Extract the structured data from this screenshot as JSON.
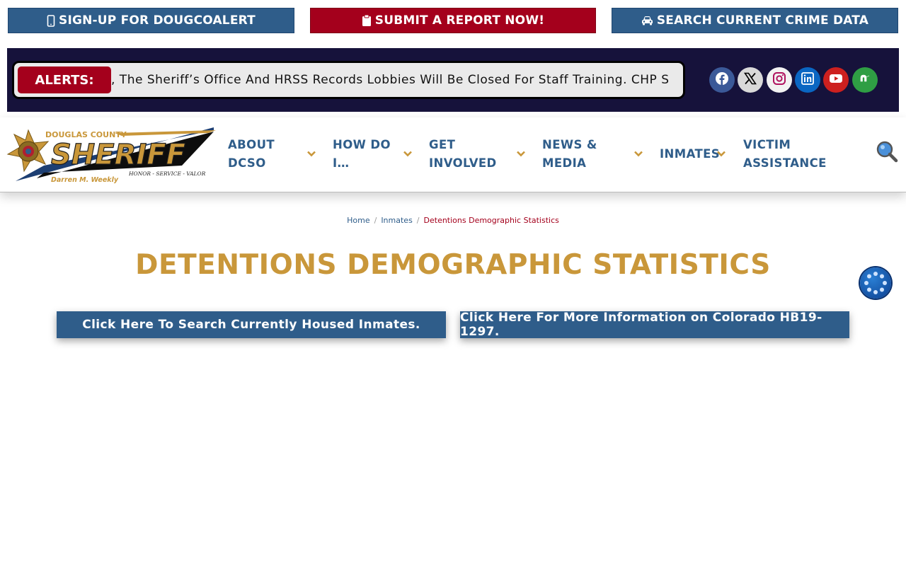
{
  "topbar": {
    "signup_label": "SIGN-UP FOR DOUGCOALERT",
    "report_label": "SUBMIT A REPORT NOW!",
    "crime_label": "SEARCH CURRENT CRIME DATA",
    "blue_color": "#2f5d8a",
    "red_color": "#a4001c"
  },
  "alerts": {
    "label": "ALERTS:",
    "text": ", The Sheriff’s Office And HRSS Records Lobbies Will Be Closed For Staff Training. CHP S",
    "bar_color": "#16123b"
  },
  "social": [
    {
      "icon": "facebook-icon",
      "color": "#3b5998"
    },
    {
      "icon": "x-twitter-icon",
      "color": "#d9d9d9"
    },
    {
      "icon": "instagram-icon",
      "color": "#f2f2f2"
    },
    {
      "icon": "linkedin-icon",
      "color": "#0a66c2"
    },
    {
      "icon": "youtube-icon",
      "color": "#cd201f"
    },
    {
      "icon": "nextdoor-icon",
      "color": "#2f9e44"
    }
  ],
  "logo": {
    "county": "DOUGLAS COUNTY",
    "title": "SHERIFF",
    "motto": "HONOR - SERVICE - VALOR",
    "sheriff_name": "Darren M. Weekly"
  },
  "nav": {
    "about_line1": "ABOUT",
    "about_line2": "DCSO",
    "howdo_line1": "HOW DO",
    "howdo_line2": "I…",
    "involved_line1": "GET",
    "involved_line2": "INVOLVED",
    "news_line1": "NEWS &",
    "news_line2": "MEDIA",
    "inmates": "INMATES",
    "victim_line1": "VICTIM",
    "victim_line2": "ASSISTANCE",
    "accent_color": "#c9973a"
  },
  "breadcrumb": {
    "home": "Home",
    "inmates": "Inmates",
    "current": "Detentions Demographic Statistics"
  },
  "page": {
    "title": "DETENTIONS DEMOGRAPHIC STATISTICS",
    "title_color": "#c9973a",
    "cta_search": "Click Here To Search Currently Housed Inmates.",
    "cta_info": "Click Here For More Information on Colorado HB19-1297."
  }
}
